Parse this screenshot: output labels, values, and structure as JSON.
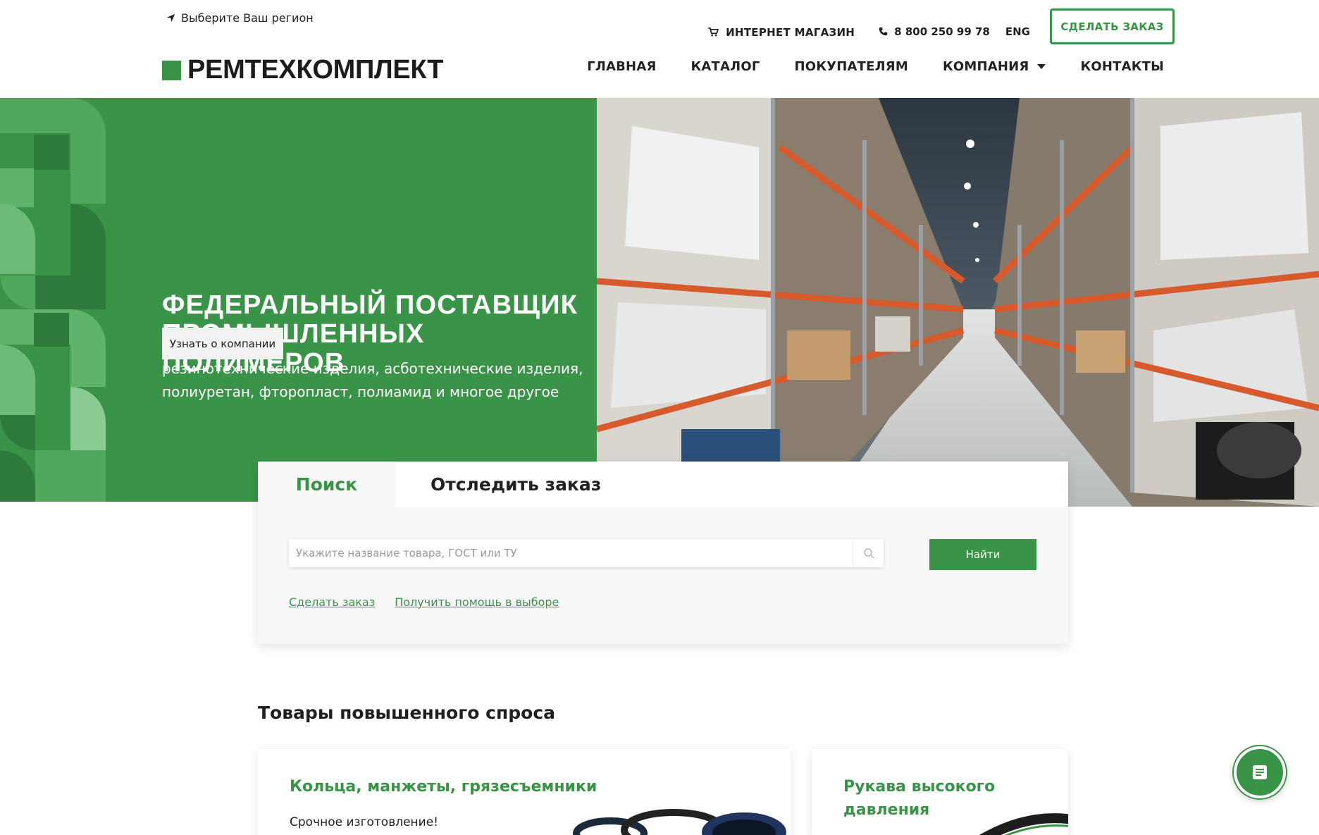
{
  "header": {
    "region_label": "Выберите Ваш регион",
    "shop_label": "ИНТЕРНЕТ МАГАЗИН",
    "phone": "8 800 250 99 78",
    "lang": "ENG",
    "order_button": "СДЕЛАТЬ ЗАКАЗ",
    "logo_text": "РЕМТЕХКОМПЛЕКТ",
    "nav": [
      "ГЛАВНАЯ",
      "КАТАЛОГ",
      "ПОКУПАТЕЛЯМ",
      "КОМПАНИЯ",
      "КОНТАКТЫ"
    ]
  },
  "hero": {
    "title_line1": "ФЕДЕРАЛЬНЫЙ ПОСТАВЩИК",
    "title_line2": "ПРОМЫШЛЕННЫХ ПОЛИМЕРОВ",
    "subtitle_line1": "резинотехнические изделия, асботехнические изделия,",
    "subtitle_line2": "полиуретан, фторопласт, полиамид и многое другое",
    "button": "Узнать о компании"
  },
  "search": {
    "tabs": [
      "Поиск",
      "Отследить заказ"
    ],
    "placeholder": "Укажите название товара, ГОСТ или ТУ",
    "value": "",
    "find_button": "Найти",
    "links": [
      "Сделать заказ",
      "Получить помощь в выборе"
    ]
  },
  "popular": {
    "title": "Товары повышенного спроса",
    "cards": [
      {
        "title": "Кольца, манжеты, грязесъемники",
        "subtitle": "Срочное изготовление!"
      },
      {
        "title": "Рукава высокого давления",
        "subtitle": ""
      }
    ]
  },
  "colors": {
    "brand_green": "#3a9447",
    "text_dark": "#1f1f1f",
    "card_bg": "#f7f7f7"
  },
  "icons": {
    "region": "location-arrow-icon",
    "shop": "cart-icon",
    "phone": "phone-icon",
    "dropdown": "caret-down-icon",
    "search": "search-icon",
    "chat": "chat-icon"
  }
}
